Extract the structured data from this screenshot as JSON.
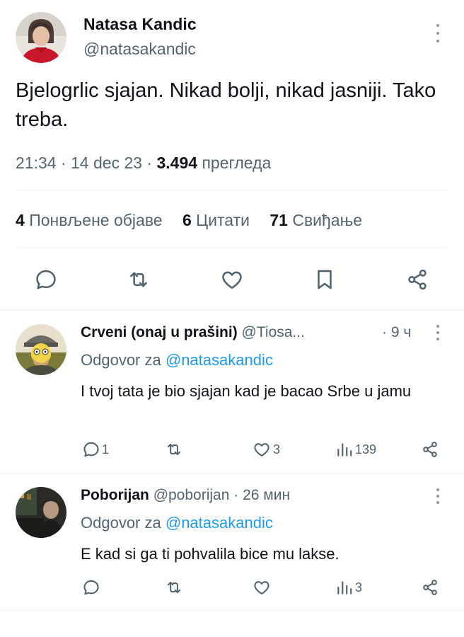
{
  "tweet": {
    "author_name": "Natasa Kandic",
    "author_handle": "@natasakandic",
    "text": "Bjelogrlic sjajan. Nikad bolji, nikad jasniji. Tako treba.",
    "time": "21:34",
    "sep1": " · ",
    "date": "14 dec 23",
    "sep2": " · ",
    "views": "3.494",
    "views_label": "прегледа",
    "stats": {
      "reposts_count": "4",
      "reposts_label": "Понвљене објаве",
      "quotes_count": "6",
      "quotes_label": "Цитати",
      "likes_count": "71",
      "likes_label": "Свиђање"
    },
    "actions": [
      "reply-icon",
      "repost-icon",
      "like-icon",
      "bookmark-icon",
      "share-icon"
    ]
  },
  "replies": [
    {
      "name": "Crveni (onaj u prašini)",
      "handle": "@Tiosa...",
      "time": "· 9 ч",
      "replying_prefix": "Odgovor za",
      "replying_to": "@natasakandic",
      "text": "I tvoj tata je bio sjajan kad je bacao Srbe u jamu",
      "replies_count": "1",
      "likes_count": "3",
      "views_count": "139"
    },
    {
      "name": "Poborijan",
      "handle": "@poborijan",
      "time": "· 26 мин",
      "replying_prefix": "Odgovor za",
      "replying_to": "@natasakandic",
      "text": "E kad si ga ti pohvalila bice mu lakse.",
      "replies_count": "",
      "likes_count": "",
      "views_count": "3"
    }
  ],
  "colors": {
    "text": "#0f1419",
    "muted": "#536471",
    "link": "#1d9bf0",
    "divider": "#eff3f4"
  }
}
